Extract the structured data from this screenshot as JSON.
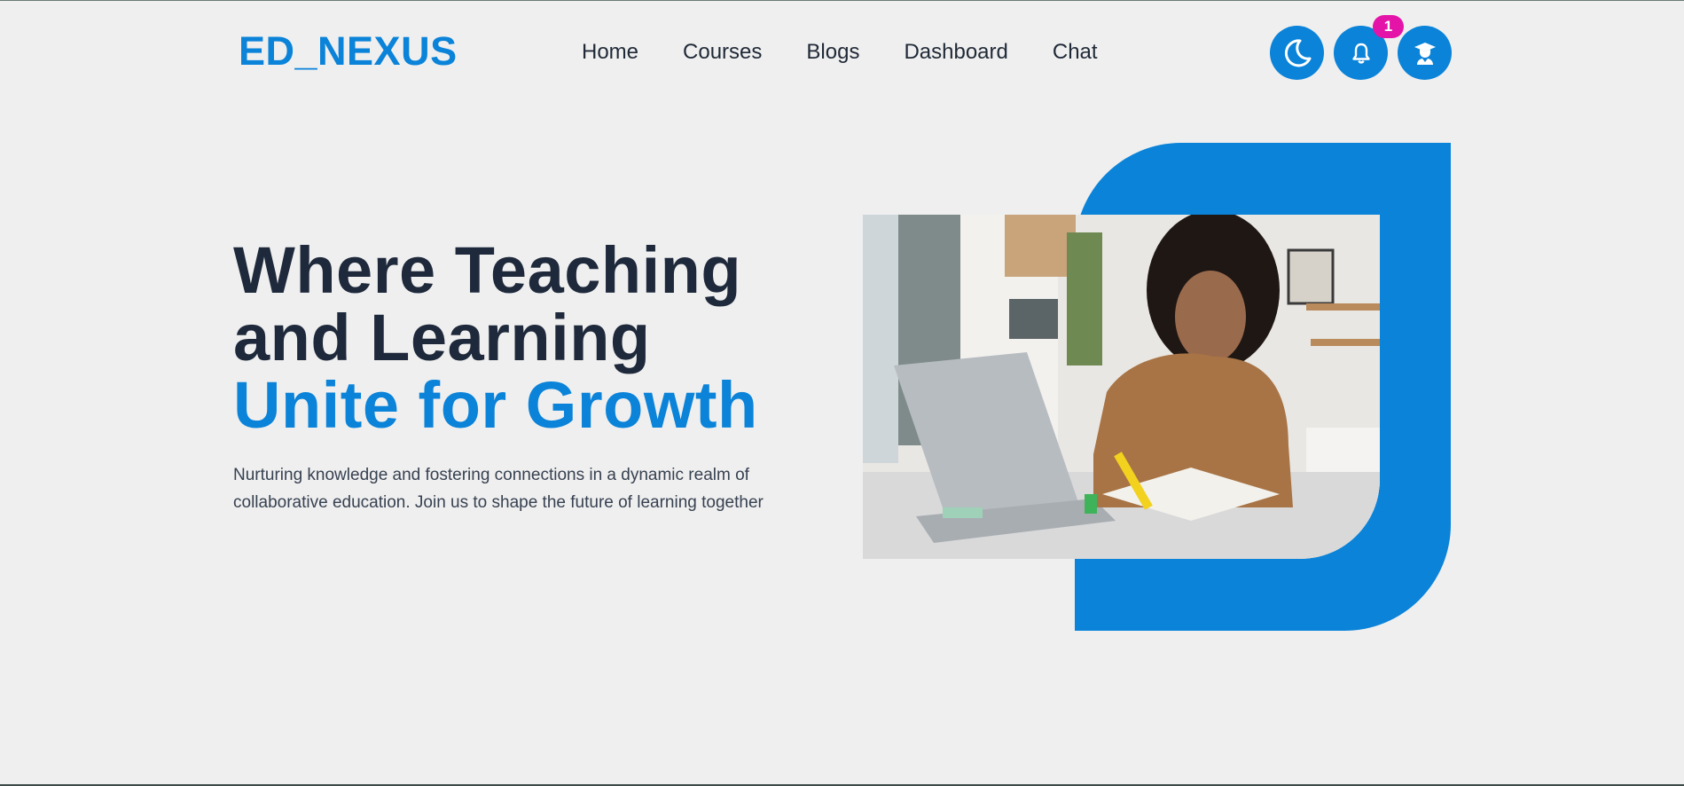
{
  "header": {
    "logo": "ED_NEXUS",
    "nav": [
      "Home",
      "Courses",
      "Blogs",
      "Dashboard",
      "Chat"
    ],
    "notification_count": "1",
    "icons": {
      "theme": "moon-icon",
      "notifications": "bell-icon",
      "profile": "graduate-icon"
    }
  },
  "hero": {
    "title_line1": "Where Teaching",
    "title_line2": "and Learning",
    "title_accent": "Unite for Growth",
    "description": "Nurturing knowledge and fostering connections in a dynamic realm of collaborative education. Join us to shape the future of learning together"
  },
  "colors": {
    "accent": "#0a83d9",
    "badge": "#e514a9",
    "text_dark": "#1e293b",
    "background": "#efefef"
  }
}
